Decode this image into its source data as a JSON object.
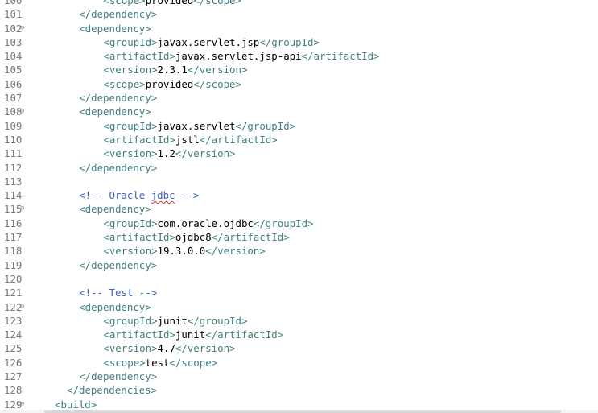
{
  "lines": [
    {
      "number": "100",
      "fold": "",
      "indent": 8,
      "parts": [
        {
          "cls": "tag",
          "text": "<scope>"
        },
        {
          "cls": "txt",
          "text": "provided"
        },
        {
          "cls": "tag",
          "text": "</scope>"
        }
      ]
    },
    {
      "number": "101",
      "fold": "",
      "indent": 4,
      "parts": [
        {
          "cls": "tag",
          "text": "</dependency>"
        }
      ]
    },
    {
      "number": "102",
      "fold": "⊖",
      "indent": 4,
      "parts": [
        {
          "cls": "tag",
          "text": "<dependency>"
        }
      ]
    },
    {
      "number": "103",
      "fold": "",
      "indent": 8,
      "parts": [
        {
          "cls": "tag",
          "text": "<groupId>"
        },
        {
          "cls": "txt",
          "text": "javax.servlet.jsp"
        },
        {
          "cls": "tag",
          "text": "</groupId>"
        }
      ]
    },
    {
      "number": "104",
      "fold": "",
      "indent": 8,
      "parts": [
        {
          "cls": "tag",
          "text": "<artifactId>"
        },
        {
          "cls": "txt",
          "text": "javax.servlet.jsp-api"
        },
        {
          "cls": "tag",
          "text": "</artifactId>"
        }
      ]
    },
    {
      "number": "105",
      "fold": "",
      "indent": 8,
      "parts": [
        {
          "cls": "tag",
          "text": "<version>"
        },
        {
          "cls": "txt",
          "text": "2.3.1"
        },
        {
          "cls": "tag",
          "text": "</version>"
        }
      ]
    },
    {
      "number": "106",
      "fold": "",
      "indent": 8,
      "parts": [
        {
          "cls": "tag",
          "text": "<scope>"
        },
        {
          "cls": "txt",
          "text": "provided"
        },
        {
          "cls": "tag",
          "text": "</scope>"
        }
      ]
    },
    {
      "number": "107",
      "fold": "",
      "indent": 4,
      "parts": [
        {
          "cls": "tag",
          "text": "</dependency>"
        }
      ]
    },
    {
      "number": "108",
      "fold": "⊖",
      "indent": 4,
      "parts": [
        {
          "cls": "tag",
          "text": "<dependency>"
        }
      ]
    },
    {
      "number": "109",
      "fold": "",
      "indent": 8,
      "parts": [
        {
          "cls": "tag",
          "text": "<groupId>"
        },
        {
          "cls": "txt",
          "text": "javax.servlet"
        },
        {
          "cls": "tag",
          "text": "</groupId>"
        }
      ]
    },
    {
      "number": "110",
      "fold": "",
      "indent": 8,
      "parts": [
        {
          "cls": "tag",
          "text": "<artifactId>"
        },
        {
          "cls": "txt",
          "text": "jstl"
        },
        {
          "cls": "tag",
          "text": "</artifactId>"
        }
      ]
    },
    {
      "number": "111",
      "fold": "",
      "indent": 8,
      "parts": [
        {
          "cls": "tag",
          "text": "<version>"
        },
        {
          "cls": "txt",
          "text": "1.2"
        },
        {
          "cls": "tag",
          "text": "</version>"
        }
      ]
    },
    {
      "number": "112",
      "fold": "",
      "indent": 4,
      "parts": [
        {
          "cls": "tag",
          "text": "</dependency>"
        }
      ]
    },
    {
      "number": "113",
      "fold": "",
      "indent": 0,
      "parts": []
    },
    {
      "number": "114",
      "fold": "",
      "indent": 4,
      "parts": [
        {
          "cls": "cmt",
          "text": "<!-- Oracle "
        },
        {
          "cls": "cmt sq",
          "text": "jdbc"
        },
        {
          "cls": "cmt",
          "text": " -->"
        }
      ]
    },
    {
      "number": "115",
      "fold": "⊖",
      "indent": 4,
      "parts": [
        {
          "cls": "tag",
          "text": "<dependency>"
        }
      ]
    },
    {
      "number": "116",
      "fold": "",
      "indent": 8,
      "parts": [
        {
          "cls": "tag",
          "text": "<groupId>"
        },
        {
          "cls": "txt",
          "text": "com.oracle.ojdbc"
        },
        {
          "cls": "tag",
          "text": "</groupId>"
        }
      ]
    },
    {
      "number": "117",
      "fold": "",
      "indent": 8,
      "parts": [
        {
          "cls": "tag",
          "text": "<artifactId>"
        },
        {
          "cls": "txt",
          "text": "ojdbc8"
        },
        {
          "cls": "tag",
          "text": "</artifactId>"
        }
      ]
    },
    {
      "number": "118",
      "fold": "",
      "indent": 8,
      "parts": [
        {
          "cls": "tag",
          "text": "<version>"
        },
        {
          "cls": "txt",
          "text": "19.3.0.0"
        },
        {
          "cls": "tag",
          "text": "</version>"
        }
      ]
    },
    {
      "number": "119",
      "fold": "",
      "indent": 4,
      "parts": [
        {
          "cls": "tag",
          "text": "</dependency>"
        }
      ]
    },
    {
      "number": "120",
      "fold": "",
      "indent": 0,
      "parts": []
    },
    {
      "number": "121",
      "fold": "",
      "indent": 4,
      "parts": [
        {
          "cls": "cmt",
          "text": "<!-- Test -->"
        }
      ]
    },
    {
      "number": "122",
      "fold": "⊖",
      "indent": 4,
      "parts": [
        {
          "cls": "tag",
          "text": "<dependency>"
        }
      ]
    },
    {
      "number": "123",
      "fold": "",
      "indent": 8,
      "parts": [
        {
          "cls": "tag",
          "text": "<groupId>"
        },
        {
          "cls": "txt",
          "text": "junit"
        },
        {
          "cls": "tag",
          "text": "</groupId>"
        }
      ]
    },
    {
      "number": "124",
      "fold": "",
      "indent": 8,
      "parts": [
        {
          "cls": "tag",
          "text": "<artifactId>"
        },
        {
          "cls": "txt",
          "text": "junit"
        },
        {
          "cls": "tag",
          "text": "</artifactId>"
        }
      ]
    },
    {
      "number": "125",
      "fold": "",
      "indent": 8,
      "parts": [
        {
          "cls": "tag",
          "text": "<version>"
        },
        {
          "cls": "txt",
          "text": "4.7"
        },
        {
          "cls": "tag",
          "text": "</version>"
        }
      ]
    },
    {
      "number": "126",
      "fold": "",
      "indent": 8,
      "parts": [
        {
          "cls": "tag",
          "text": "<scope>"
        },
        {
          "cls": "txt",
          "text": "test"
        },
        {
          "cls": "tag",
          "text": "</scope>"
        }
      ]
    },
    {
      "number": "127",
      "fold": "",
      "indent": 4,
      "parts": [
        {
          "cls": "tag",
          "text": "</dependency>"
        }
      ]
    },
    {
      "number": "128",
      "fold": "",
      "indent": 2,
      "parts": [
        {
          "cls": "tag",
          "text": "</dependencies>"
        }
      ]
    },
    {
      "number": "129",
      "fold": "⊖",
      "indent": 0,
      "parts": [
        {
          "cls": "tag",
          "text": "<build>"
        }
      ]
    }
  ]
}
